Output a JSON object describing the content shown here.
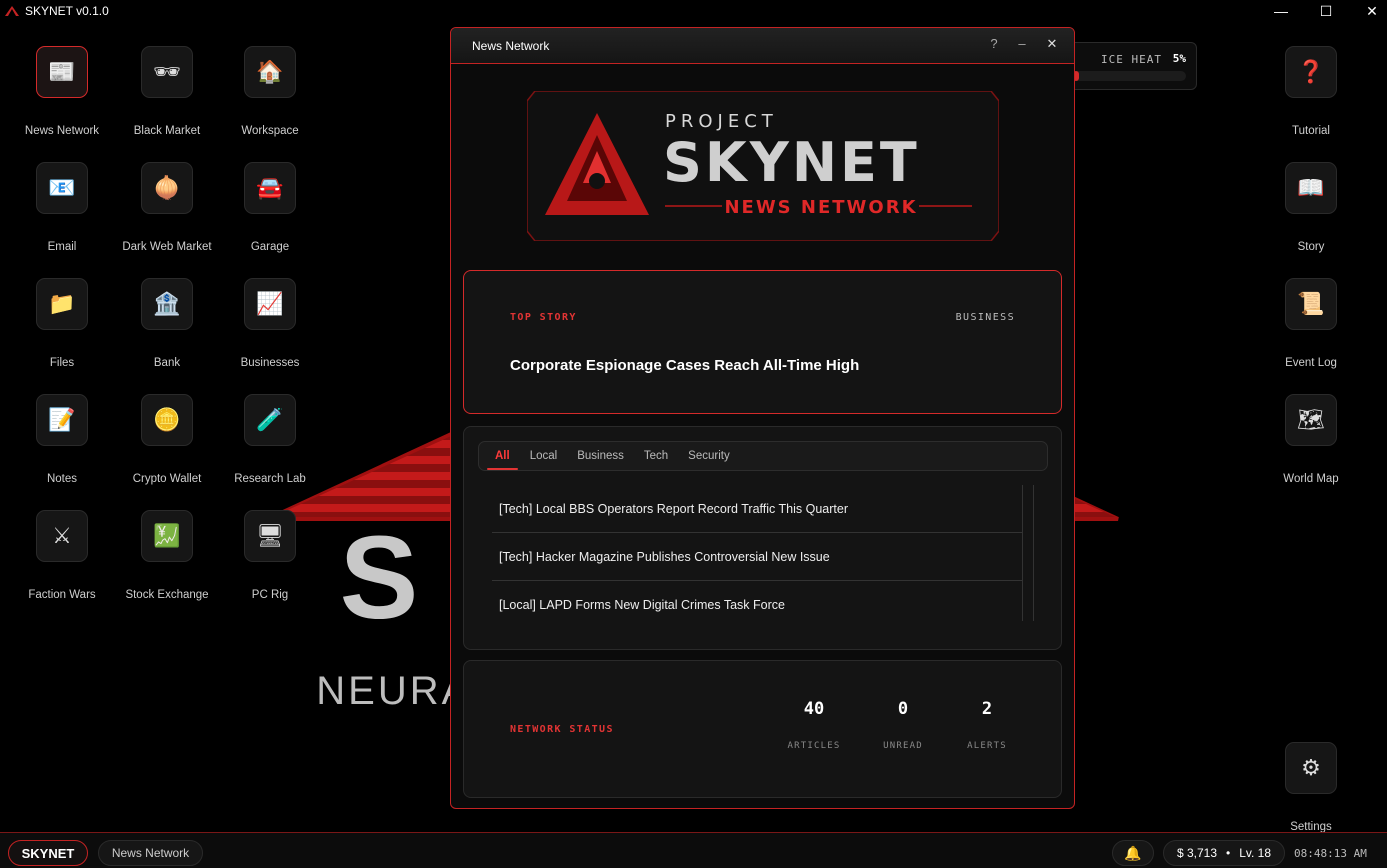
{
  "titlebar": {
    "title": "SKYNET v0.1.0",
    "minimize": "—",
    "maximize": "☐",
    "close": "✕"
  },
  "wallpaper": {
    "big_text": "SKYNET",
    "sub_text": "NEURAL NETWORK INTELLIGENCE"
  },
  "desktop_left": [
    {
      "label": "News Network",
      "icon": "newspaper-icon",
      "glyph": "📰"
    },
    {
      "label": "Black Market",
      "icon": "mask-icon",
      "glyph": "🕶"
    },
    {
      "label": "Workspace",
      "icon": "house-icon",
      "glyph": "🏠"
    },
    {
      "label": "Email",
      "icon": "email-icon",
      "glyph": "📧"
    },
    {
      "label": "Dark Web Market",
      "icon": "onion-icon",
      "glyph": "🧅"
    },
    {
      "label": "Garage",
      "icon": "car-icon",
      "glyph": "🚘"
    },
    {
      "label": "Files",
      "icon": "folder-icon",
      "glyph": "📁"
    },
    {
      "label": "Bank",
      "icon": "bank-icon",
      "glyph": "🏦"
    },
    {
      "label": "Businesses",
      "icon": "chart-icon",
      "glyph": "📈"
    },
    {
      "label": "Notes",
      "icon": "notes-icon",
      "glyph": "📝"
    },
    {
      "label": "Crypto Wallet",
      "icon": "coin-icon",
      "glyph": "🪙"
    },
    {
      "label": "Research Lab",
      "icon": "test-tube-icon",
      "glyph": "🧪"
    },
    {
      "label": "Faction Wars",
      "icon": "swords-icon",
      "glyph": "⚔"
    },
    {
      "label": "Stock Exchange",
      "icon": "stock-icon",
      "glyph": "💹"
    },
    {
      "label": "PC Rig",
      "icon": "computer-icon",
      "glyph": "🖥"
    }
  ],
  "desktop_right": [
    {
      "label": "Tutorial",
      "icon": "question-icon",
      "glyph": "❓"
    },
    {
      "label": "Story",
      "icon": "book-icon",
      "glyph": "📖"
    },
    {
      "label": "Event Log",
      "icon": "scroll-icon",
      "glyph": "📜"
    },
    {
      "label": "World Map",
      "icon": "map-icon",
      "glyph": "🗺"
    },
    {
      "label": "Settings",
      "icon": "gear-icon",
      "glyph": "⚙"
    }
  ],
  "heat": {
    "label": "ICE HEAT",
    "value": "5%",
    "fraction": 0.05
  },
  "window": {
    "title": "News Network",
    "help": "?",
    "minimize": "–",
    "close": "✕",
    "banner": {
      "line1": "PROJECT",
      "line2": "SKYNET",
      "line3": "NEWS NETWORK"
    },
    "top_story": {
      "kicker": "TOP STORY",
      "category": "BUSINESS",
      "headline": "Corporate Espionage Cases Reach All-Time High"
    },
    "tabs": [
      "All",
      "Local",
      "Business",
      "Tech",
      "Security"
    ],
    "active_tab": 0,
    "items": [
      "[Tech] Local BBS Operators Report Record Traffic This Quarter",
      "[Tech] Hacker Magazine Publishes Controversial New Issue",
      "[Local] LAPD Forms New Digital Crimes Task Force"
    ],
    "status": {
      "label": "NETWORK STATUS",
      "stats": [
        {
          "value": "40",
          "label": "ARTICLES"
        },
        {
          "value": "0",
          "label": "UNREAD"
        },
        {
          "value": "2",
          "label": "ALERTS"
        }
      ]
    }
  },
  "taskbar": {
    "start": "SKYNET",
    "task": "News Network",
    "money": "$ 3,713",
    "sep": "•",
    "level": "Lv. 18",
    "clock": "08:48:13 AM"
  },
  "colors": {
    "accent": "#d42a2a",
    "bg": "#000000",
    "panel": "#141414"
  }
}
